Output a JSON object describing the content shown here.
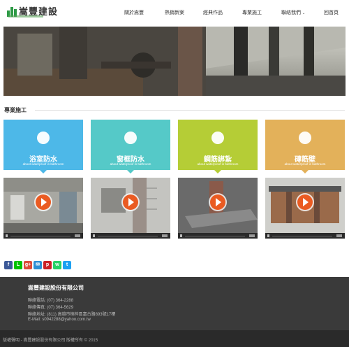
{
  "header": {
    "logo_text": "嵩豐建設",
    "nav": [
      {
        "label": "關於嵩豐"
      },
      {
        "label": "熱銷新案"
      },
      {
        "label": "經典作品"
      },
      {
        "label": "專業施工"
      },
      {
        "label": "聯絡我們"
      },
      {
        "label": "回首頁"
      }
    ]
  },
  "section": {
    "title": "專業施工"
  },
  "cards": [
    {
      "title": "浴室防水",
      "subtitle": "about waterproof in bathroom",
      "color": "#4db8e8",
      "icon": "shower-icon"
    },
    {
      "title": "窗框防水",
      "subtitle": "about waterproof in bathroom",
      "color": "#55c9c8",
      "icon": "window-icon"
    },
    {
      "title": "鋼筋綁紮",
      "subtitle": "about waterproof in bathroom",
      "color": "#b5cd36",
      "icon": "rebar-icon"
    },
    {
      "title": "磚筋壁",
      "subtitle": "about waterproof in bathroom",
      "color": "#e3b15a",
      "icon": "brick-icon"
    }
  ],
  "videos": [
    {
      "icon": "play-icon"
    },
    {
      "icon": "play-icon"
    },
    {
      "icon": "play-icon"
    },
    {
      "icon": "play-icon"
    }
  ],
  "social": [
    {
      "name": "facebook-icon",
      "glyph": "f",
      "color": "#3b5998"
    },
    {
      "name": "line-icon",
      "glyph": "L",
      "color": "#00c300"
    },
    {
      "name": "google-plus-icon",
      "glyph": "g+",
      "color": "#dd4b39"
    },
    {
      "name": "email-icon",
      "glyph": "✉",
      "color": "#2d8fd5"
    },
    {
      "name": "pinterest-icon",
      "glyph": "p",
      "color": "#cb2027"
    },
    {
      "name": "whatsapp-icon",
      "glyph": "w",
      "color": "#25d366"
    },
    {
      "name": "twitter-icon",
      "glyph": "t",
      "color": "#1da1f2"
    }
  ],
  "footer": {
    "company": "嵩豐建設股份有限公司",
    "phone": "聯絡電話: (07) 364-2288",
    "fax": "聯絡傳真: (07) 364-5629",
    "address": "聯絡地址: (811) 高雄市楠梓區富台路893號17樓",
    "email": "E-Mail: s0942288@yahoo.com.tw",
    "copyright": "版權聲明 - 嵩豐建設股份有限公司 版權所有 © 2015"
  }
}
